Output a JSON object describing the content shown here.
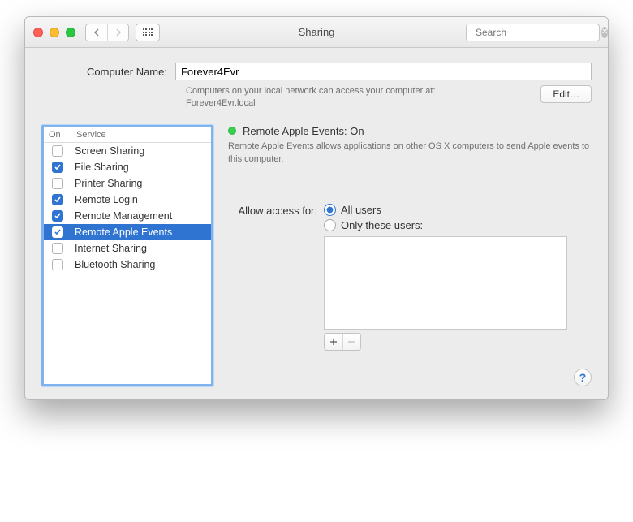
{
  "window": {
    "title": "Sharing"
  },
  "search": {
    "placeholder": "Search"
  },
  "computer_name": {
    "label": "Computer Name:",
    "value": "Forever4Evr",
    "subtext_line1": "Computers on your local network can access your computer at:",
    "subtext_line2": "Forever4Evr.local",
    "edit_label": "Edit…"
  },
  "services": {
    "header_on": "On",
    "header_service": "Service",
    "items": [
      {
        "label": "Screen Sharing",
        "on": false,
        "selected": false
      },
      {
        "label": "File Sharing",
        "on": true,
        "selected": false
      },
      {
        "label": "Printer Sharing",
        "on": false,
        "selected": false
      },
      {
        "label": "Remote Login",
        "on": true,
        "selected": false
      },
      {
        "label": "Remote Management",
        "on": true,
        "selected": false
      },
      {
        "label": "Remote Apple Events",
        "on": true,
        "selected": true
      },
      {
        "label": "Internet Sharing",
        "on": false,
        "selected": false
      },
      {
        "label": "Bluetooth Sharing",
        "on": false,
        "selected": false
      }
    ]
  },
  "detail": {
    "status_text": "Remote Apple Events: On",
    "status_color": "#3bcf4e",
    "description": "Remote Apple Events allows applications on other OS X computers to send Apple events to this computer.",
    "access_label": "Allow access for:",
    "radio_all": "All users",
    "radio_only": "Only these users:",
    "selected_radio": "all"
  },
  "help": {
    "label": "?"
  }
}
